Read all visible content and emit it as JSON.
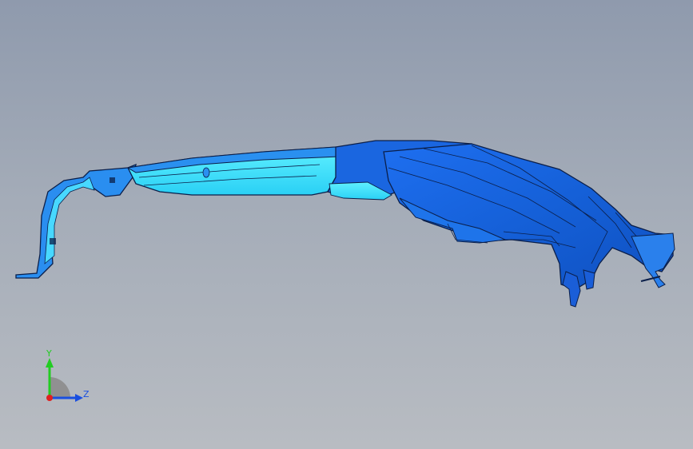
{
  "viewport": {
    "background_top": "#8f9aad",
    "background_bottom": "#b8bcc2"
  },
  "model": {
    "part_color": "#1a66e0",
    "part_highlight": "#3fe6ff",
    "edge_color": "#0b1f4a"
  },
  "triad": {
    "y_label": "Y",
    "z_label": "Z",
    "y_color": "#22cc22",
    "z_color": "#1a4fe0",
    "x_color": "#e02020"
  }
}
